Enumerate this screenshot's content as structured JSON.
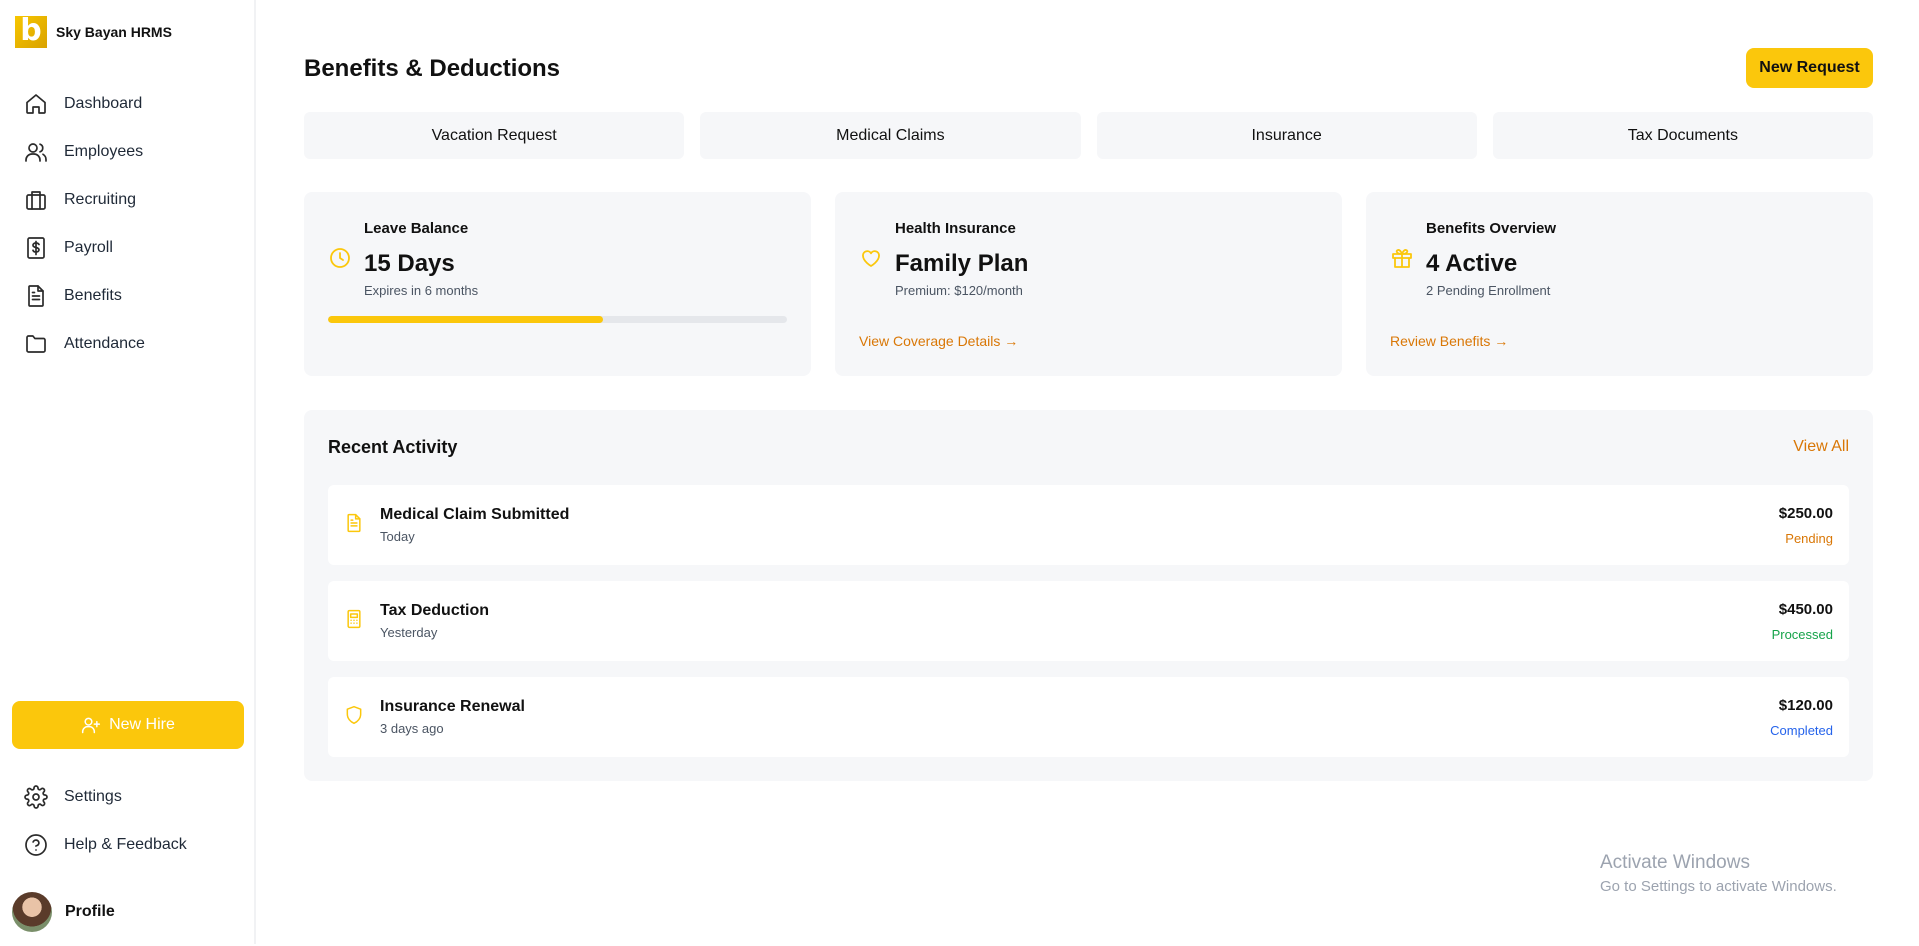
{
  "brand": {
    "logo_letter": "b",
    "name": "Sky Bayan HRMS"
  },
  "sidebar": {
    "items": [
      {
        "label": "Dashboard",
        "icon": "home-icon"
      },
      {
        "label": "Employees",
        "icon": "users-icon"
      },
      {
        "label": "Recruiting",
        "icon": "briefcase-icon"
      },
      {
        "label": "Payroll",
        "icon": "dollar-doc-icon"
      },
      {
        "label": "Benefits",
        "icon": "document-icon"
      },
      {
        "label": "Attendance",
        "icon": "folder-icon"
      }
    ],
    "new_hire_label": "New Hire",
    "bottom_items": [
      {
        "label": "Settings",
        "icon": "gear-icon"
      },
      {
        "label": "Help & Feedback",
        "icon": "help-icon"
      }
    ],
    "profile_label": "Profile"
  },
  "header": {
    "title": "Benefits & Deductions",
    "new_request_label": "New Request"
  },
  "tabs": [
    {
      "label": "Vacation Request"
    },
    {
      "label": "Medical Claims"
    },
    {
      "label": "Insurance"
    },
    {
      "label": "Tax Documents"
    }
  ],
  "cards": {
    "leave": {
      "title": "Leave Balance",
      "value": "15 Days",
      "sub": "Expires in 6 months",
      "progress_percent": 60,
      "icon": "clock-icon"
    },
    "health": {
      "title": "Health Insurance",
      "value": "Family Plan",
      "sub": "Premium: $120/month",
      "link": "View Coverage Details →",
      "icon": "heart-icon"
    },
    "benefits": {
      "title": "Benefits Overview",
      "value": "4 Active",
      "sub": "2 Pending Enrollment",
      "link": "Review Benefits →",
      "icon": "gift-icon"
    }
  },
  "activity": {
    "title": "Recent Activity",
    "view_all": "View All",
    "rows": [
      {
        "title": "Medical Claim Submitted",
        "time": "Today",
        "amount": "$250.00",
        "status": "Pending",
        "status_color": "#d97706",
        "icon": "document-icon"
      },
      {
        "title": "Tax Deduction",
        "time": "Yesterday",
        "amount": "$450.00",
        "status": "Processed",
        "status_color": "#16a34a",
        "icon": "calculator-icon"
      },
      {
        "title": "Insurance Renewal",
        "time": "3 days ago",
        "amount": "$120.00",
        "status": "Completed",
        "status_color": "#2563eb",
        "icon": "shield-icon"
      }
    ]
  },
  "watermark": {
    "line1": "Activate Windows",
    "line2": "Go to Settings to activate Windows."
  },
  "colors": {
    "accent": "#fbc70c",
    "link": "#d97706",
    "panel": "#f6f7f9"
  }
}
